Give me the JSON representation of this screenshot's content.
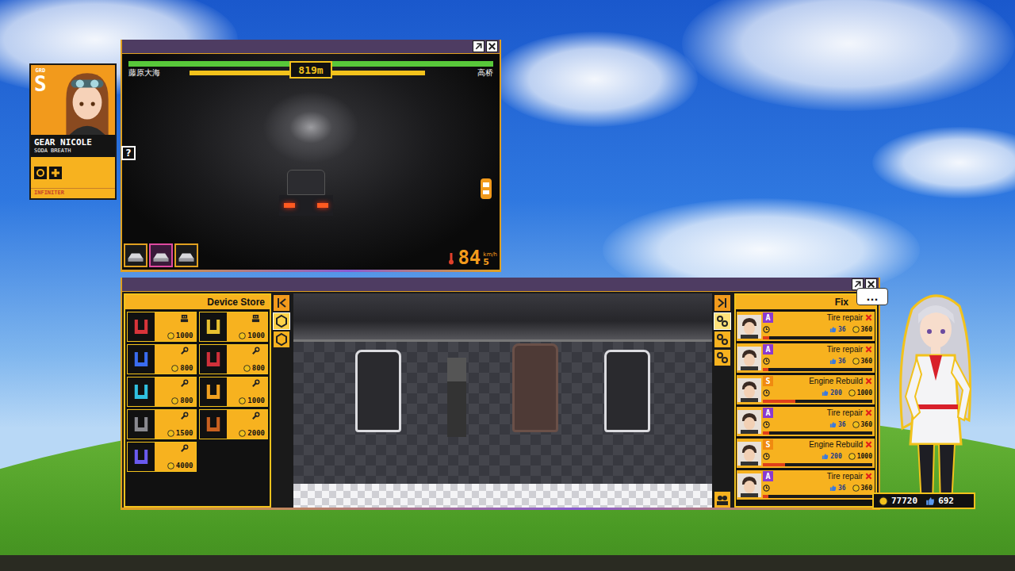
{
  "character_card": {
    "grade_label": "GRD",
    "grade": "S",
    "name": "GEAR NICOLE",
    "trait": "SODA BREATH",
    "tag": "INFINITER"
  },
  "race_window": {
    "driver_left": "藤原大海",
    "driver_right": "高桥",
    "distance": "819m",
    "health_left": 1,
    "health_right": 1,
    "boost_left": 0.8,
    "boost_right": 0.66,
    "help": "?",
    "speed": "84",
    "speed_unit": "km/h",
    "gear": "5",
    "car_slots": [
      {
        "selected": false
      },
      {
        "selected": true
      },
      {
        "selected": false
      }
    ]
  },
  "garage_window": {
    "store_title": "Device Store",
    "store_tabs": [
      {
        "selected": true
      },
      {
        "selected": false
      }
    ],
    "store_items": [
      {
        "price": "1000",
        "kind": "staff",
        "color": "#d8343a"
      },
      {
        "price": "1000",
        "kind": "staff",
        "color": "#e8c030"
      },
      {
        "price": "800",
        "kind": "tool",
        "color": "#3a6cf0"
      },
      {
        "price": "800",
        "kind": "tool",
        "color": "#d0303a"
      },
      {
        "price": "800",
        "kind": "tool",
        "color": "#30c0e0"
      },
      {
        "price": "1000",
        "kind": "tool",
        "color": "#f0a020"
      },
      {
        "price": "1500",
        "kind": "tool",
        "color": "#8a8a90"
      },
      {
        "price": "2000",
        "kind": "tool",
        "color": "#c86020"
      },
      {
        "price": "4000",
        "kind": "tool",
        "color": "#6a5af0"
      }
    ],
    "panel_tabs": [
      {
        "selected": true
      },
      {
        "selected": false
      },
      {
        "selected": false
      }
    ],
    "fix_title": "Fix",
    "fix_jobs": [
      {
        "name": "Tire repair",
        "grade": "A",
        "color": "#8a3ad0",
        "likes": "36",
        "cost": "360",
        "level": 0.06
      },
      {
        "name": "Tire repair",
        "grade": "A",
        "color": "#8a3ad0",
        "likes": "36",
        "cost": "360",
        "level": 0.05
      },
      {
        "name": "Engine Rebuild",
        "grade": "S",
        "color": "#f08a10",
        "likes": "200",
        "cost": "1000",
        "level": 0.3
      },
      {
        "name": "Tire repair",
        "grade": "A",
        "color": "#8a3ad0",
        "likes": "36",
        "cost": "360",
        "level": 0.06
      },
      {
        "name": "Engine Rebuild",
        "grade": "S",
        "color": "#f08a10",
        "likes": "200",
        "cost": "1000",
        "level": 0.2
      },
      {
        "name": "Tire repair",
        "grade": "A",
        "color": "#8a3ad0",
        "likes": "36",
        "cost": "360",
        "level": 0.05
      }
    ]
  },
  "speech_bubble": "...",
  "wallet": {
    "coins": "77720",
    "likes": "692"
  }
}
